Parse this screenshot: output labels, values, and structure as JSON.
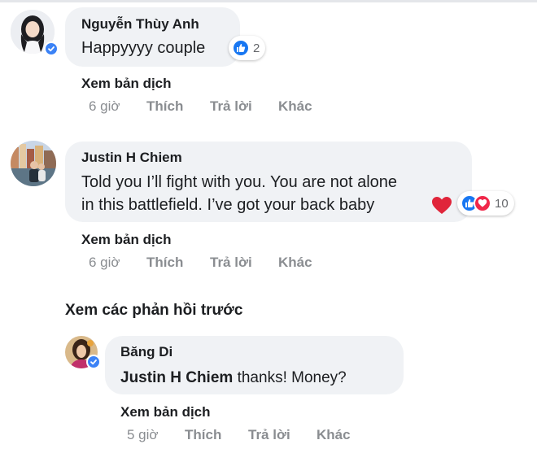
{
  "comments": [
    {
      "name": "Nguyễn Thùy Anh",
      "text": "Happyyyy couple",
      "reaction_count": "2",
      "translate": "Xem bản dịch",
      "time": "6 giờ",
      "like": "Thích",
      "reply": "Trả lời",
      "more": "Khác"
    },
    {
      "name": "Justin H Chiem",
      "text_line1": "Told you I’ll fight with you. You are not alone",
      "text_line2": "in this battlefield. I’ve got your back baby",
      "reaction_count": "10",
      "translate": "Xem bản dịch",
      "time": "6 giờ",
      "like": "Thích",
      "reply": "Trả lời",
      "more": "Khác"
    }
  ],
  "view_previous_replies": "Xem các phản hồi trước",
  "reply": {
    "name": "Băng Di",
    "mention": "Justin H Chiem",
    "text": " thanks! Money?",
    "translate": "Xem bản dịch",
    "time": "5 giờ",
    "like": "Thích",
    "reply": "Trả lời",
    "more": "Khác"
  },
  "colors": {
    "bubble": "#f0f2f5",
    "like_blue": "#1877f2",
    "love_red": "#f0284a",
    "verified_blue": "#3b82f6",
    "muted": "#8a8d91"
  },
  "icons": [
    "verified-badge-icon",
    "like-reaction-icon",
    "love-reaction-icon",
    "heart-emoji-icon"
  ]
}
